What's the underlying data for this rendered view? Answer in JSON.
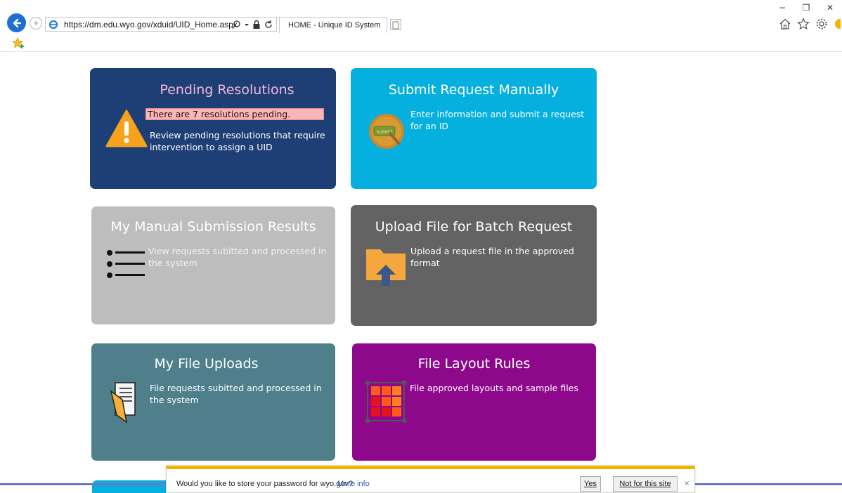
{
  "browser": {
    "url": "https://dm.edu.wyo.gov/xduid/UID_Home.aspx",
    "tab_title": "HOME - Unique ID System",
    "tab_close": "×",
    "window_controls": [
      "−",
      "❐",
      "✕"
    ]
  },
  "tiles": {
    "pending": {
      "title": "Pending Resolutions",
      "alert": "There are 7 resolutions pending.",
      "description": "Review pending resolutions that require intervention to assign a UID",
      "color": "#1e3f76",
      "title_color": "#f4b6d6"
    },
    "submit": {
      "title": "Submit Request Manually",
      "description": "Enter information and submit a request for an ID",
      "color": "#05afde"
    },
    "results": {
      "title": "My Manual Submission Results",
      "description": "View requests subitted and processed in the system",
      "color": "#bdbdbd"
    },
    "upload": {
      "title": "Upload File for Batch Request",
      "description": "Upload a request file in the approved format",
      "color": "#636363"
    },
    "myfiles": {
      "title": "My File Uploads",
      "description": "File requests subitted and processed in the system",
      "color": "#4e7f8a"
    },
    "layout": {
      "title": "File Layout Rules",
      "description": "File approved layouts and sample files",
      "color": "#8e088c"
    }
  },
  "notification": {
    "message": "Would you like to store your password for wyo.gov?",
    "link": "More info",
    "yes": "Yes",
    "no": "Not for this site",
    "close": "×"
  }
}
